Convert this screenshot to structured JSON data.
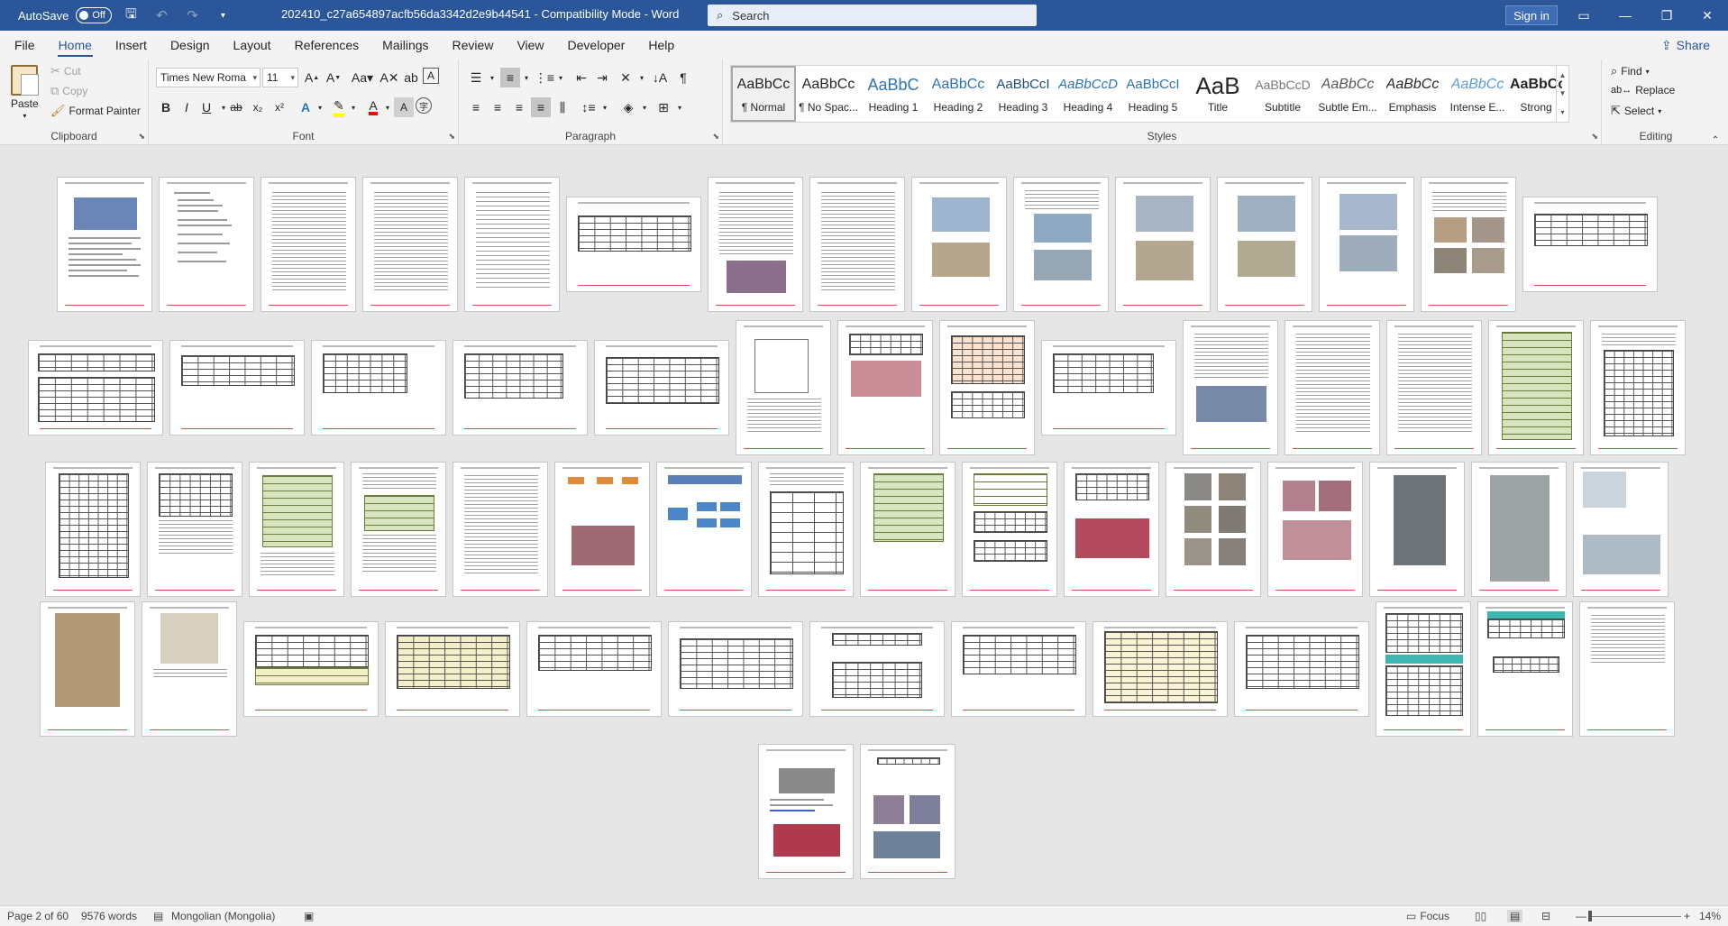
{
  "titlebar": {
    "autosave_label": "AutoSave",
    "autosave_state": "Off",
    "document_title": "202410_c27a654897acfb56da3342d2e9b44541  -  Compatibility Mode  -  Word",
    "search_placeholder": "Search",
    "signin_label": "Sign in"
  },
  "tabs": [
    "File",
    "Home",
    "Insert",
    "Design",
    "Layout",
    "References",
    "Mailings",
    "Review",
    "View",
    "Developer",
    "Help"
  ],
  "share_label": "Share",
  "clipboard": {
    "paste": "Paste",
    "cut": "Cut",
    "copy": "Copy",
    "format_painter": "Format Painter",
    "label": "Clipboard"
  },
  "font": {
    "name": "Times New Roma",
    "size": "11",
    "label": "Font"
  },
  "paragraph": {
    "label": "Paragraph"
  },
  "styles": {
    "label": "Styles",
    "items": [
      {
        "sample": "AaBbCc",
        "name": "¶ Normal"
      },
      {
        "sample": "AaBbCc",
        "name": "¶ No Spac..."
      },
      {
        "sample": "AaBbC",
        "name": "Heading 1"
      },
      {
        "sample": "AaBbCc",
        "name": "Heading 2"
      },
      {
        "sample": "AaBbCcI",
        "name": "Heading 3"
      },
      {
        "sample": "AaBbCcD",
        "name": "Heading 4"
      },
      {
        "sample": "AaBbCcI",
        "name": "Heading 5"
      },
      {
        "sample": "AaB",
        "name": "Title"
      },
      {
        "sample": "AaBbCcD",
        "name": "Subtitle"
      },
      {
        "sample": "AaBbCc",
        "name": "Subtle Em..."
      },
      {
        "sample": "AaBbCc",
        "name": "Emphasis"
      },
      {
        "sample": "AaBbCc",
        "name": "Intense E..."
      },
      {
        "sample": "AaBbCc",
        "name": "Strong"
      }
    ]
  },
  "editing": {
    "find": "Find",
    "replace": "Replace",
    "select": "Select",
    "label": "Editing"
  },
  "status": {
    "page": "Page 2 of 60",
    "words": "9576 words",
    "language": "Mongolian (Mongolia)",
    "focus": "Focus",
    "zoom": "14%"
  },
  "colors": {
    "titlebar": "#2b579a",
    "ribbon": "#f3f3f3",
    "canvas": "#e6e6e6",
    "heading_blue": "#2e74b5",
    "font_color_red": "#ff0000",
    "highlight_yellow": "#ffff00"
  }
}
